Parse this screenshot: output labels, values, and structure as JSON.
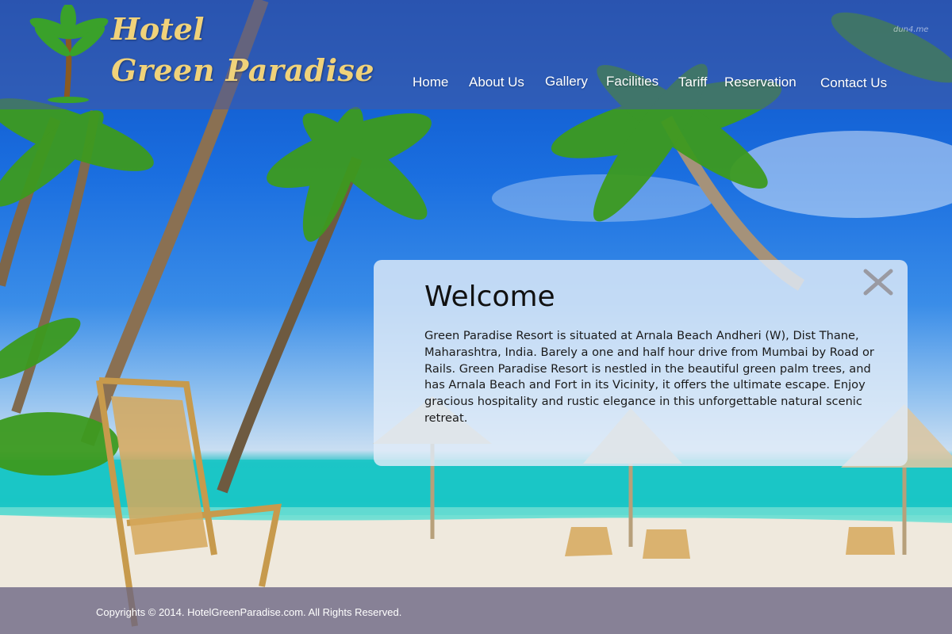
{
  "brand": {
    "line1": "Hotel",
    "line2": "Green Paradise",
    "color": "#f0d27a",
    "logo_icon": "palm-tree-icon"
  },
  "watermark": "dun4.me",
  "nav": {
    "items": [
      {
        "label": "Home"
      },
      {
        "label": "About Us"
      },
      {
        "label": "Gallery"
      },
      {
        "label": "Facilities"
      },
      {
        "label": "Tariff"
      },
      {
        "label": "Reservation"
      },
      {
        "label": "Contact Us"
      }
    ]
  },
  "welcome": {
    "title": "Welcome",
    "body": "Green Paradise Resort is situated at Arnala Beach Andheri (W), Dist Thane, Maharashtra, India. Barely a one and half hour drive from Mumbai by Road or Rails. Green Paradise Resort is nestled in the beautiful green palm trees, and has Arnala Beach and Fort in its Vicinity, it offers the ultimate escape. Enjoy gracious hospitality and rustic elegance in this unforgettable natural scenic retreat.",
    "close_icon": "close-icon"
  },
  "footer": {
    "copyright": "Copyrights © 2014. HotelGreenParadise.com. All Rights Reserved."
  },
  "colors": {
    "header_bg": "#465aa0",
    "footer_bg": "#696482",
    "panel_bg": "#e1ebf8"
  }
}
